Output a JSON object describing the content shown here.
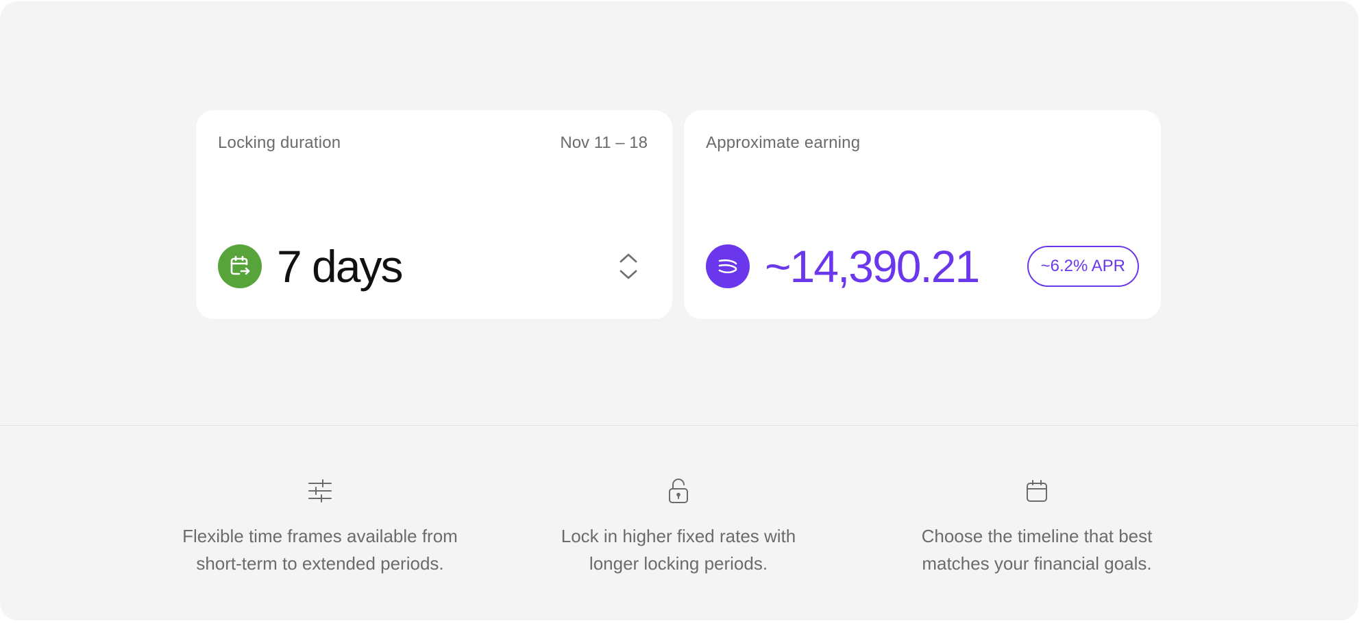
{
  "colors": {
    "panel_bg": "#f4f4f4",
    "card_bg": "#ffffff",
    "accent_green": "#57a43b",
    "accent_purple": "#6a37ec",
    "muted_text": "#6b6b6b"
  },
  "locking_card": {
    "label": "Locking duration",
    "date_range": "Nov 11 – 18",
    "value": "7 days",
    "icon": "calendar-arrow-icon",
    "control_icon": "chevron-up-down-icon"
  },
  "earning_card": {
    "label": "Approximate earning",
    "value": "~14,390.21",
    "icon": "token-logo-icon",
    "apr_badge": "~6.2% APR"
  },
  "features": [
    {
      "icon": "sliders-icon",
      "line1": "Flexible time frames available from",
      "line2": "short-term to extended periods."
    },
    {
      "icon": "lock-icon",
      "line1": "Lock in higher fixed rates with",
      "line2": "longer locking periods."
    },
    {
      "icon": "calendar-icon",
      "line1": "Choose the timeline that best",
      "line2": "matches your financial goals."
    }
  ]
}
